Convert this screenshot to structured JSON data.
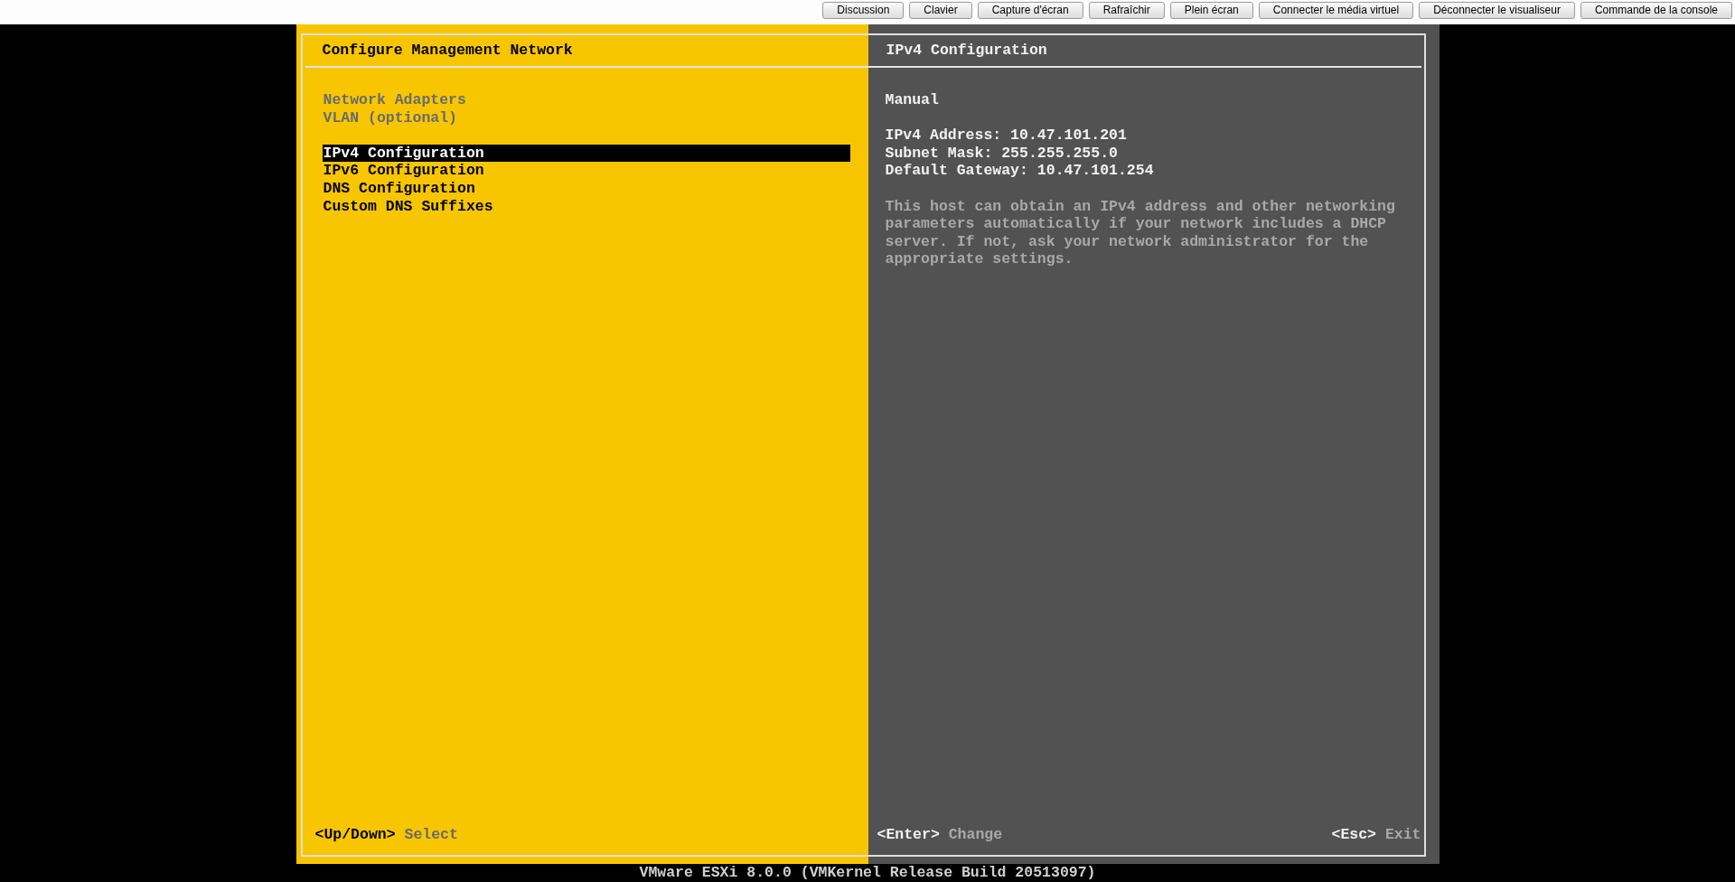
{
  "toolbar": {
    "buttons": [
      "Discussion",
      "Clavier",
      "Capture d'écran",
      "Rafraîchir",
      "Plein écran",
      "Connecter le média virtuel",
      "Déconnecter le visualiseur",
      "Commande de la console"
    ]
  },
  "console": {
    "left_panel": {
      "title": "Configure Management Network",
      "menu_groups": [
        {
          "items": [
            {
              "label": "Network Adapters",
              "disabled": true,
              "selected": false
            },
            {
              "label": "VLAN (optional)",
              "disabled": true,
              "selected": false
            }
          ]
        },
        {
          "items": [
            {
              "label": "IPv4 Configuration",
              "disabled": false,
              "selected": true
            },
            {
              "label": "IPv6 Configuration",
              "disabled": false,
              "selected": false
            },
            {
              "label": "DNS Configuration",
              "disabled": false,
              "selected": false
            },
            {
              "label": "Custom DNS Suffixes",
              "disabled": false,
              "selected": false
            }
          ]
        }
      ],
      "footer": [
        {
          "key": "<Up/Down>",
          "action": "Select"
        }
      ]
    },
    "right_panel": {
      "title": "IPv4 Configuration",
      "mode": "Manual",
      "settings": [
        "IPv4 Address: 10.47.101.201",
        "Subnet Mask: 255.255.255.0",
        "Default Gateway: 10.47.101.254"
      ],
      "description": "This host can obtain an IPv4 address and other networking parameters automatically if your network includes a DHCP server. If not, ask your network administrator for the appropriate settings.",
      "footer": [
        {
          "key": "<Enter>",
          "action": "Change"
        },
        {
          "key": "<Esc>",
          "action": "Exit"
        }
      ]
    }
  },
  "status_bar": {
    "text": "VMware ESXi 8.0.0 (VMKernel Release Build 20513097)"
  }
}
